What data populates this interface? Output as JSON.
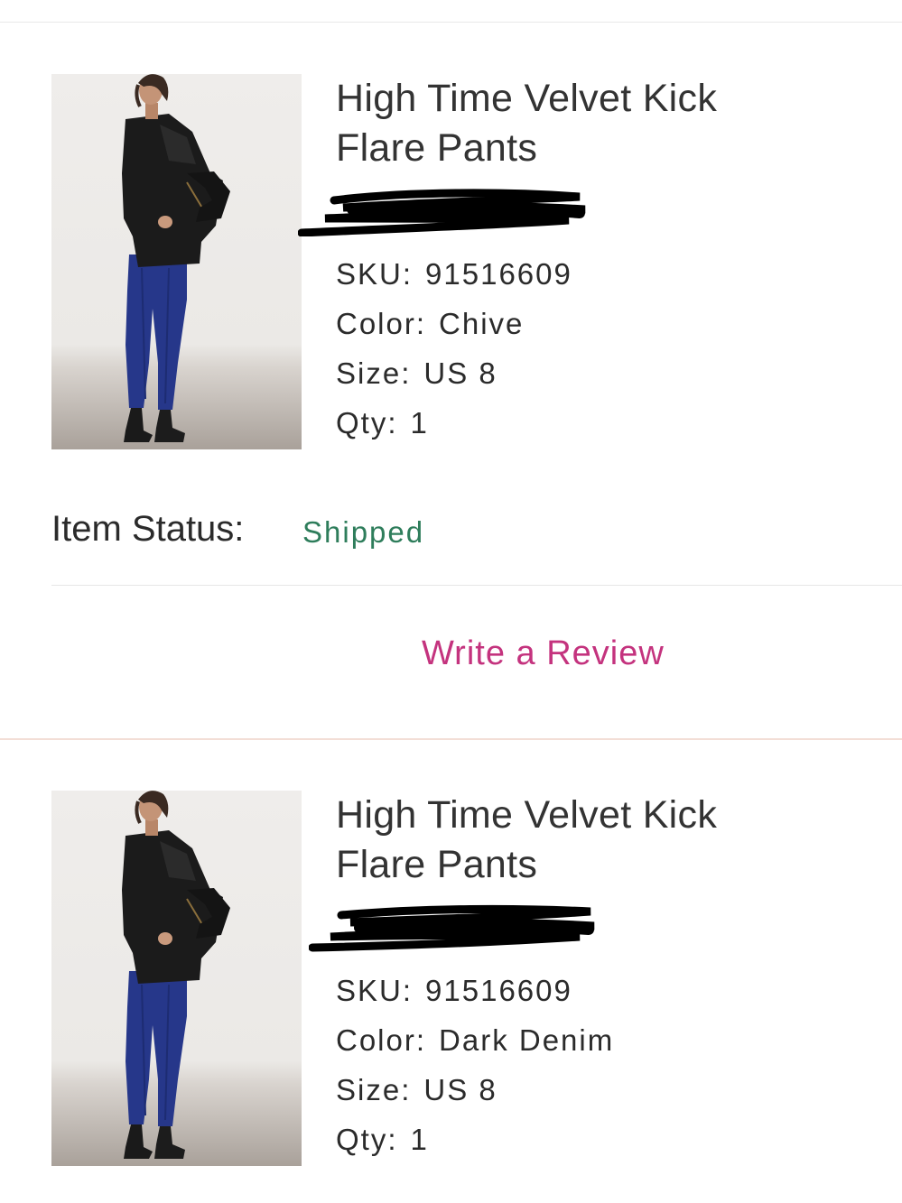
{
  "items": [
    {
      "title": "High Time Velvet Kick Flare Pants",
      "sku_label": "SKU:",
      "sku": "91516609",
      "color_label": "Color:",
      "color": "Chive",
      "size_label": "Size:",
      "size": "US 8",
      "qty_label": "Qty:",
      "qty": "1",
      "status_label": "Item Status:",
      "status": "Shipped",
      "review_label": "Write a Review"
    },
    {
      "title": "High Time Velvet Kick Flare Pants",
      "sku_label": "SKU:",
      "sku": "91516609",
      "color_label": "Color:",
      "color": "Dark Denim",
      "size_label": "Size:",
      "size": "US 8",
      "qty_label": "Qty:",
      "qty": "1"
    }
  ],
  "colors": {
    "status_shipped": "#2e7d5b",
    "review_link": "#c4337e",
    "price_redaction": "#000000"
  }
}
